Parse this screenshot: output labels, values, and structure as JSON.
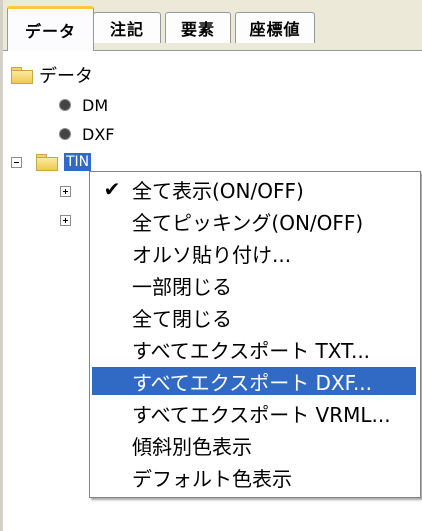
{
  "tabs": [
    {
      "label": "データ",
      "active": true
    },
    {
      "label": "注記",
      "active": false
    },
    {
      "label": "要素",
      "active": false
    },
    {
      "label": "座標値",
      "active": false
    }
  ],
  "tree": {
    "root_label": "データ",
    "items": [
      {
        "label": "DM"
      },
      {
        "label": "DXF"
      }
    ],
    "selected_label": "TIN"
  },
  "context_menu": {
    "items": [
      {
        "label": "全て表示(ON/OFF)",
        "checked": true
      },
      {
        "label": "全てピッキング(ON/OFF)"
      },
      {
        "label": "オルソ貼り付け..."
      },
      {
        "label": "一部閉じる"
      },
      {
        "label": "全て閉じる"
      },
      {
        "label": "すべてエクスポート TXT..."
      },
      {
        "label": "すべてエクスポート DXF...",
        "highlighted": true
      },
      {
        "label": "すべてエクスポート VRML..."
      },
      {
        "label": "傾斜別色表示"
      },
      {
        "label": "デフォルト色表示"
      }
    ],
    "check_glyph": "✔"
  },
  "colors": {
    "selection": "#316ac5",
    "tab_accent": "#ffc83c",
    "folder": "#f0c850"
  }
}
